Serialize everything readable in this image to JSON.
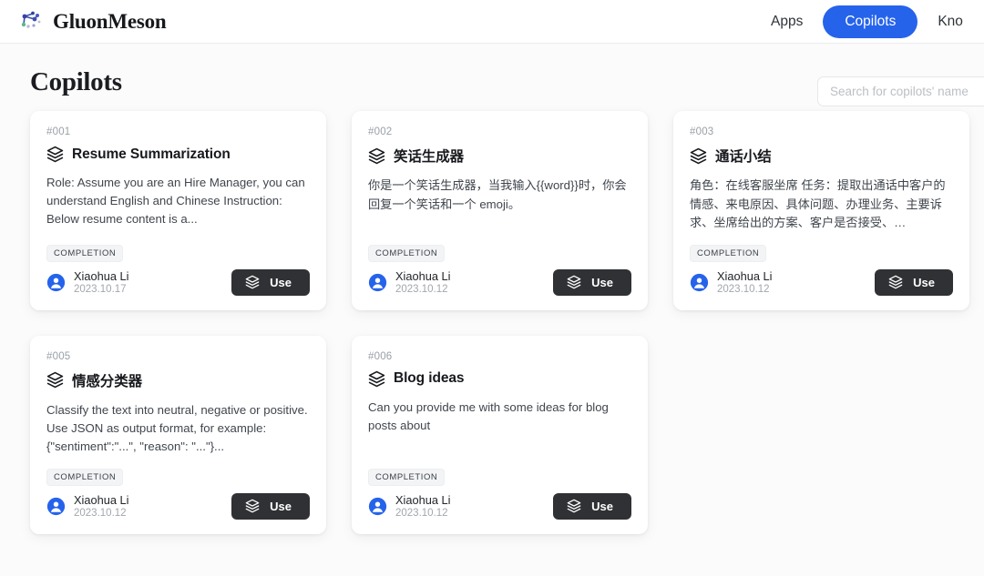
{
  "header": {
    "brand_name": "GluonMeson",
    "logo_icon": "network-graph-icon",
    "nav": [
      {
        "label": "Apps",
        "active": false
      },
      {
        "label": "Copilots",
        "active": true
      },
      {
        "label": "Kno",
        "active": false
      }
    ],
    "accent_color": "#2563eb"
  },
  "page": {
    "title": "Copilots",
    "search_placeholder": "Search for copilots' name",
    "search_value": ""
  },
  "cards": [
    {
      "id": "#001",
      "icon": "layers-icon",
      "title": "Resume Summarization",
      "description": "Role: Assume you are an Hire Manager, you can understand English and Chinese Instruction: Below resume content is a...",
      "badge": "COMPLETION",
      "author": "Xiaohua Li",
      "date": "2023.10.17",
      "action_label": "Use"
    },
    {
      "id": "#002",
      "icon": "layers-icon",
      "title": "笑话生成器",
      "description": "你是一个笑话生成器，当我输入{{word}}时，你会回复一个笑话和一个 emoji。",
      "badge": "COMPLETION",
      "author": "Xiaohua Li",
      "date": "2023.10.12",
      "action_label": "Use"
    },
    {
      "id": "#003",
      "icon": "layers-icon",
      "title": "通话小结",
      "description": "角色：在线客服坐席 任务：提取出通话中客户的情感、来电原因、具体问题、办理业务、主要诉求、坐席给出的方案、客户是否接受、…",
      "badge": "COMPLETION",
      "author": "Xiaohua Li",
      "date": "2023.10.12",
      "action_label": "Use"
    },
    {
      "id": "#005",
      "icon": "layers-icon",
      "title": "情感分类器",
      "description": "Classify the text into neutral, negative or positive. Use JSON as output format, for example: {\"sentiment\":\"...\", \"reason\": \"...\"}...",
      "badge": "COMPLETION",
      "author": "Xiaohua Li",
      "date": "2023.10.12",
      "action_label": "Use"
    },
    {
      "id": "#006",
      "icon": "layers-icon",
      "title": "Blog ideas",
      "description": "Can you provide me with some ideas for blog posts about",
      "badge": "COMPLETION",
      "author": "Xiaohua Li",
      "date": "2023.10.12",
      "action_label": "Use"
    }
  ]
}
